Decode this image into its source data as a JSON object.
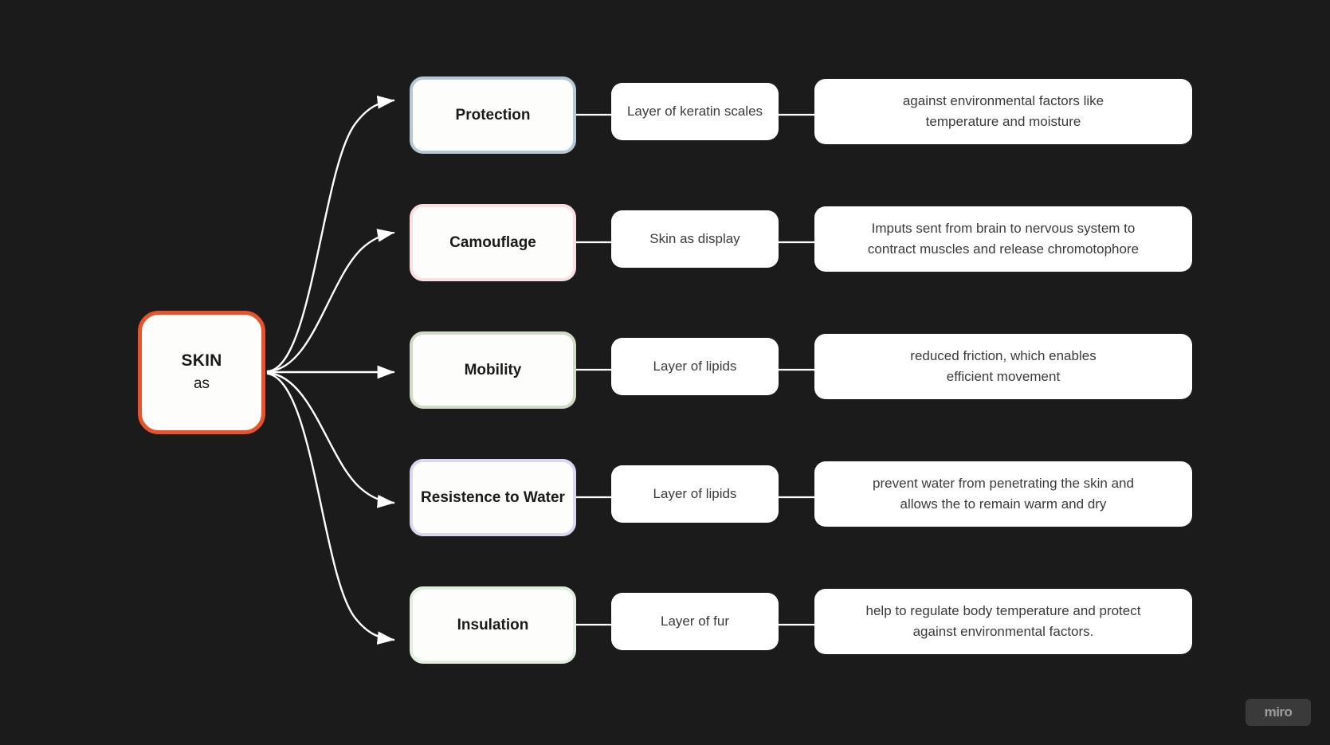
{
  "canvas": {
    "background_color": "#1b1b1b",
    "watermark": "miro"
  },
  "root": {
    "title": "SKIN",
    "subtitle": "as",
    "border_color": "#e8532b"
  },
  "branches": [
    {
      "label": "Protection",
      "border_color": "#b4c7d4",
      "mechanism": "Layer of keratin scales",
      "detail": "against environmental factors like\ntemperature and moisture"
    },
    {
      "label": "Camouflage",
      "border_color": "#fadfe0",
      "mechanism": "Skin as display",
      "detail": "Imputs sent from brain to nervous system to\ncontract muscles and release chromotophore"
    },
    {
      "label": "Mobility",
      "border_color": "#cfdbc6",
      "mechanism": "Layer of lipids",
      "detail": "reduced friction, which enables\nefficient movement"
    },
    {
      "label": "Resistence to Water",
      "border_color": "#ddd6f3",
      "mechanism": "Layer of lipids",
      "detail": "prevent water from penetrating the skin and\nallows the to remain warm and dry"
    },
    {
      "label": "Insulation",
      "border_color": "#e1f0dd",
      "mechanism": "Layer of fur",
      "detail": "help to regulate body temperature and protect\nagainst environmental factors."
    }
  ],
  "connector_color": "#ffffff"
}
